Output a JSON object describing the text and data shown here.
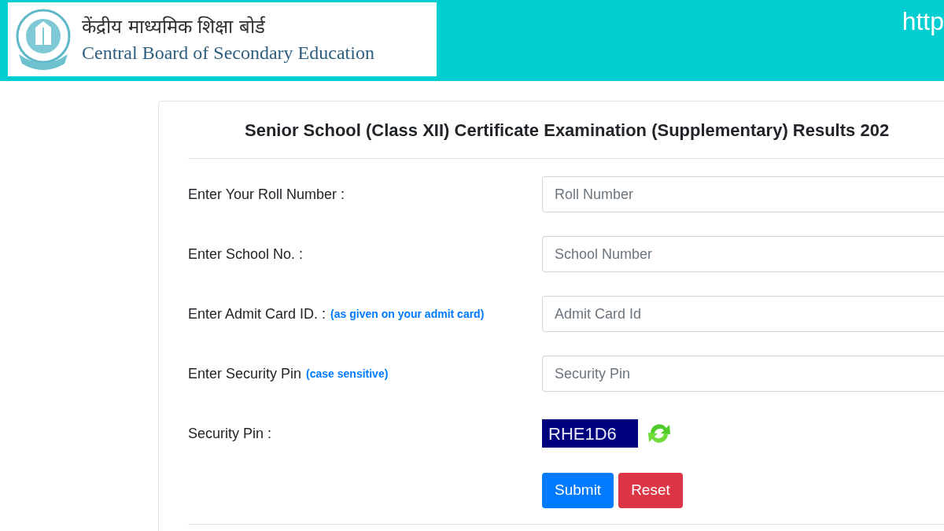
{
  "header": {
    "logo_hindi": "केंद्रीय माध्यमिक शिक्षा बोर्ड",
    "logo_english": "Central Board of Secondary Education",
    "url_text": "http"
  },
  "form": {
    "title": "Senior School (Class XII) Certificate Examination (Supplementary) Results 202",
    "fields": [
      {
        "kind": "input",
        "label": "Enter Your Roll Number :",
        "placeholder": "Roll Number"
      },
      {
        "kind": "input",
        "label": "Enter School No. :",
        "placeholder": "School Number"
      },
      {
        "kind": "input",
        "label": "Enter Admit Card ID. :",
        "hint": "(as given on your admit card)",
        "placeholder": "Admit Card Id"
      },
      {
        "kind": "input",
        "label": "Enter Security Pin",
        "hint": "(case sensitive)",
        "placeholder": "Security Pin"
      },
      {
        "kind": "captcha",
        "label": "Security Pin :",
        "code": "RHE1D6"
      }
    ],
    "buttons": [
      {
        "kind": "primary",
        "label": "Submit"
      },
      {
        "kind": "danger",
        "label": "Reset"
      }
    ]
  }
}
